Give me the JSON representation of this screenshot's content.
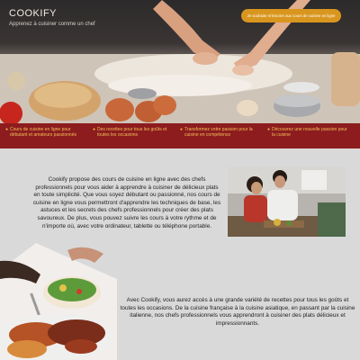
{
  "header": {
    "brand": "COOKIFY",
    "tagline": "Apprenez à cuisiner comme un chef",
    "cta_label": "Je souhaite m'inscrire aux cours de cuisine en ligne"
  },
  "features": [
    {
      "text": "Cours de cuisine en ligne pour débutant et amateurs passionnés",
      "icon": "bullet-icon"
    },
    {
      "text": "Des recettes pour tous les goûts et toutes les occasions",
      "icon": "bullet-icon"
    },
    {
      "text": "Transformez votre passion pour la cuisine en compétence",
      "icon": "bullet-icon"
    },
    {
      "text": "Découvrez une nouvelle passion pour la cuisine",
      "icon": "bullet-icon"
    }
  ],
  "sections": {
    "intro_text": "Cookify propose des cours de cuisine en ligne avec des chefs professionnels pour vous aider à apprendre à cuisiner de délicieux plats en toute simplicité. Que vous soyez débutant ou passionné, nos cours de cuisine en ligne vous permettront d'apprendre les techniques de base, les astuces et les secrets des chefs professionnels pour créer des plats savoureux. De plus, vous pouvez suivre les cours à votre rythme et de n'importe où, avec votre ordinateur, tablette ou téléphone portable.",
    "recipes_text": "Avec Cookify, vous aurez accès à une grande variété de recettes pour tous les goûts et toutes les occasions. De la cuisine française à la cuisine asiatique, en passant par la cuisine italienne, nos chefs professionnels vous apprendront à cuisiner des plats délicieux et impressionnants."
  },
  "colors": {
    "accent": "#d9961e",
    "feature_bar": "#8c1c1e",
    "feature_text": "#f3c05a",
    "page_bg": "#d9d9d9"
  }
}
